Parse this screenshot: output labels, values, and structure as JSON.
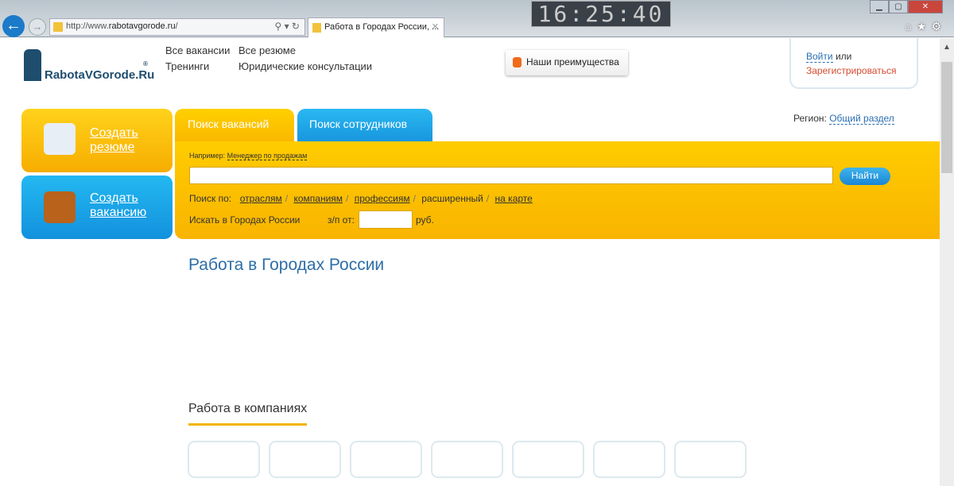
{
  "browser": {
    "url_prefix": "http://www.",
    "url_domain": "rabotavgorode.ru",
    "url_suffix": "/",
    "tab_title": "Работа в Городах России, ...",
    "clock": "16:25:40"
  },
  "logo": "RabotaVGorode.Ru",
  "nav": {
    "col1": [
      "Все вакансии",
      "Тренинги"
    ],
    "col2": [
      "Все резюме",
      "Юридические консультации"
    ]
  },
  "advantages": "Наши преимущества",
  "login": {
    "login": "Войти",
    "or": "или",
    "register": "Зарегистрироваться"
  },
  "region": {
    "label": "Регион:",
    "value": "Общий раздел"
  },
  "side": {
    "resume_1": "Создать",
    "resume_2": "резюме",
    "vacancy_1": "Создать",
    "vacancy_2": "вакансию"
  },
  "tabs": {
    "vacancies": "Поиск вакансий",
    "employees": "Поиск сотрудников"
  },
  "search": {
    "example_label": "Например:",
    "example": "Менеджер по продажам",
    "query": "",
    "button": "Найти",
    "by_label": "Поиск по:",
    "by": [
      "отраслям",
      "компаниям",
      "профессиям",
      "расширенный",
      "на карте"
    ],
    "city": "Искать в Городах России",
    "salary_label": "з/п от:",
    "salary": "",
    "currency": "руб."
  },
  "main": {
    "title": "Работа в Городах России",
    "companies_title": "Работа в компаниях"
  },
  "colors": {
    "yellow": "#f9b600",
    "blue": "#1895de",
    "link": "#2a6fb3"
  }
}
